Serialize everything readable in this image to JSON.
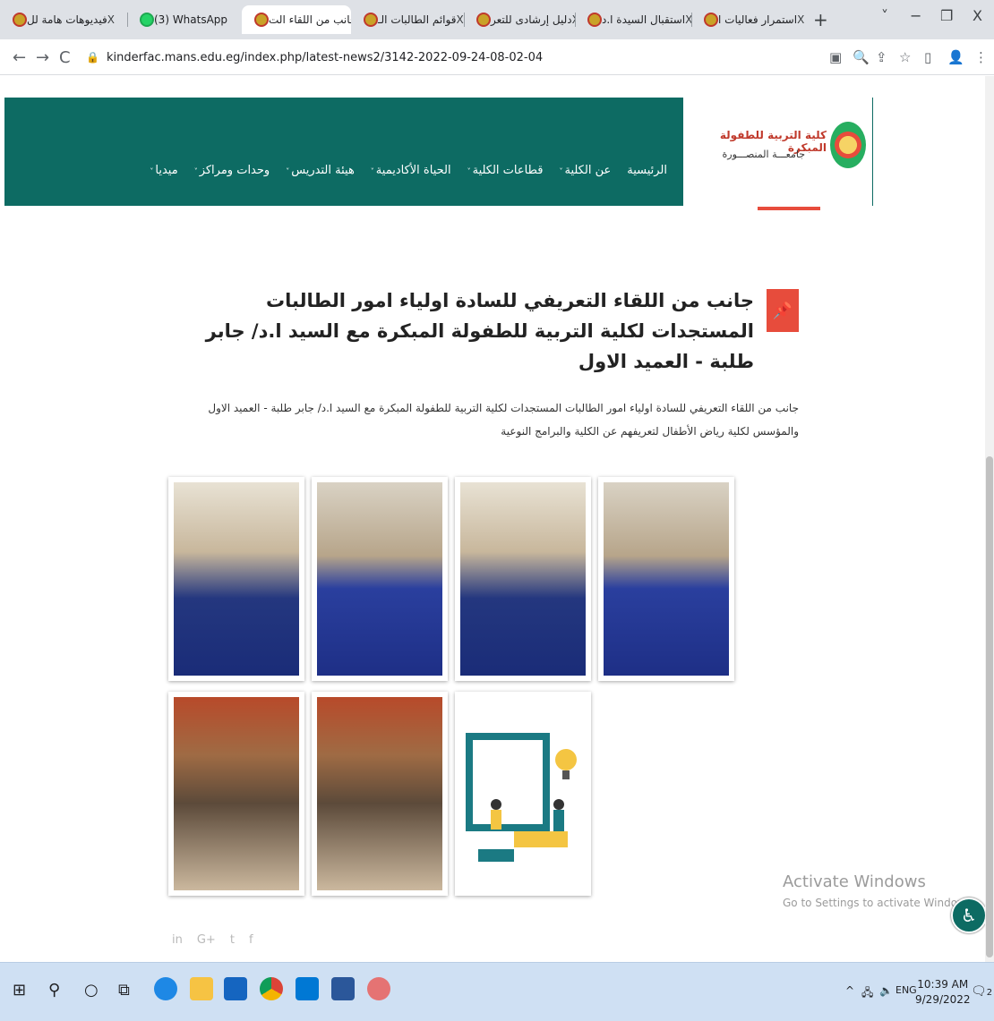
{
  "browser": {
    "tabs": [
      {
        "title": "فيديوهات هامة لل",
        "active": false
      },
      {
        "title": "(3) WhatsApp",
        "active": false
      },
      {
        "title": "جانب من اللقاء الت",
        "active": true
      },
      {
        "title": "قوائم الطالبات الـ",
        "active": false
      },
      {
        "title": "دليل إرشادى للتعر",
        "active": false
      },
      {
        "title": "استقبال السيدة ا.د",
        "active": false
      },
      {
        "title": "استمرار فعاليات ا",
        "active": false
      }
    ],
    "new_tab": "+",
    "url": "kinderfac.mans.edu.eg/index.php/latest-news2/3142-2022-09-24-08-02-04",
    "close_glyph": "X"
  },
  "site": {
    "logo_title": "كلية التربية للطفولة المبكرة",
    "logo_subtitle": "جامعـــة المنصـــورة",
    "nav": [
      "الرئيسية",
      "عن الكلية",
      "قطاعات الكلية",
      "الحياة الأكاديمية",
      "هيئة التدريس",
      "وحدات ومراكز",
      "ميديا"
    ],
    "nav_chevron": "˅"
  },
  "article": {
    "title": "جانب من اللقاء التعريفي للسادة اولياء امور الطالبات المستجدات لكلية التربية للطفولة المبكرة مع السيد ا.د/ جابر طلبة - العميد الاول",
    "body": "جانب من اللقاء التعريفي للسادة اولياء امور الطالبات المستجدات لكلية التربية للطفولة المبكرة مع السيد ا.د/ جابر طلبة - العميد الاول والمؤسس لكلية رياض الأطفال لتعريفهم عن الكلية والبرامج النوعية",
    "pin_icon": "📌"
  },
  "social": [
    "in",
    "G+",
    "t",
    "f"
  ],
  "overlay": {
    "activate_title": "Activate Windows",
    "activate_sub": "Go to Settings to activate Windows."
  },
  "taskbar": {
    "lang": "ENG",
    "time": "10:39 AM",
    "date": "9/29/2022",
    "notifications": "2"
  }
}
